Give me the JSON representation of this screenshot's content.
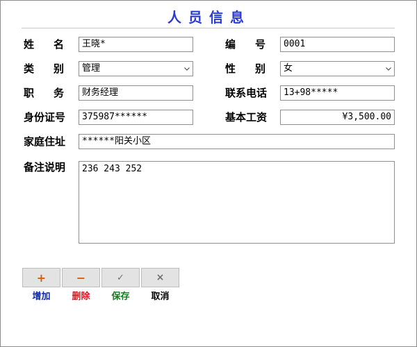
{
  "title": "人员信息",
  "colors": {
    "title": "#2a3bd1",
    "add": "#0b27b8",
    "delete": "#e0141b",
    "save": "#147a1e",
    "cancel": "#000000",
    "add_icon": "#d85a10",
    "delete_icon": "#d85a10",
    "save_icon": "#707070",
    "cancel_icon": "#707070"
  },
  "fields": {
    "name": {
      "label_a": "姓",
      "label_b": "名",
      "value": "王晓*"
    },
    "number": {
      "label_a": "编",
      "label_b": "号",
      "value": "0001"
    },
    "category": {
      "label_a": "类",
      "label_b": "别",
      "value": "管理"
    },
    "gender": {
      "label_a": "性",
      "label_b": "别",
      "value": "女"
    },
    "position": {
      "label_a": "职",
      "label_b": "务",
      "value": "财务经理"
    },
    "phone": {
      "label": "联系电话",
      "value": "13+98*****"
    },
    "id_number": {
      "label": "身份证号",
      "value": "375987******"
    },
    "salary": {
      "label": "基本工资",
      "value": "¥3,500.00"
    },
    "address": {
      "label": "家庭住址",
      "value": "******阳关小区"
    },
    "notes": {
      "label": "备注说明",
      "value": "236 243 252"
    }
  },
  "buttons": {
    "add": {
      "glyph": "+",
      "label": "增加"
    },
    "delete": {
      "glyph": "−",
      "label": "删除"
    },
    "save": {
      "glyph": "✓",
      "label": "保存"
    },
    "cancel": {
      "glyph": "×",
      "label": "取消"
    }
  }
}
